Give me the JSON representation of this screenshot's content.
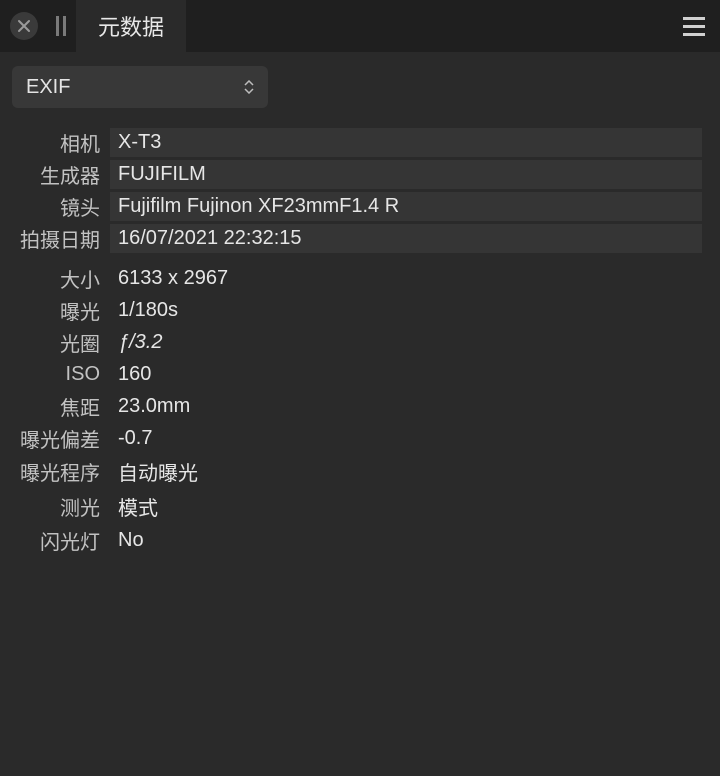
{
  "header": {
    "tab_title": "元数据"
  },
  "dropdown": {
    "selected": "EXIF"
  },
  "metadata": {
    "camera": {
      "label": "相机",
      "value": "X-T3"
    },
    "maker": {
      "label": "生成器",
      "value": "FUJIFILM"
    },
    "lens": {
      "label": "镜头",
      "value": "Fujifilm Fujinon XF23mmF1.4 R"
    },
    "datetime": {
      "label": "拍摄日期",
      "value": "16/07/2021 22:32:15"
    },
    "size": {
      "label": "大小",
      "value": "6133 x 2967"
    },
    "exposure": {
      "label": "曝光",
      "value": "1/180s"
    },
    "aperture": {
      "label": "光圈",
      "value": "ƒ/3.2"
    },
    "iso": {
      "label": "ISO",
      "value": "160"
    },
    "focal": {
      "label": "焦距",
      "value": "23.0mm"
    },
    "evcomp": {
      "label": "曝光偏差",
      "value": "-0.7"
    },
    "program": {
      "label": "曝光程序",
      "value": "自动曝光"
    },
    "metering": {
      "label": "测光",
      "value": "模式"
    },
    "flash": {
      "label": "闪光灯",
      "value": "No"
    }
  }
}
